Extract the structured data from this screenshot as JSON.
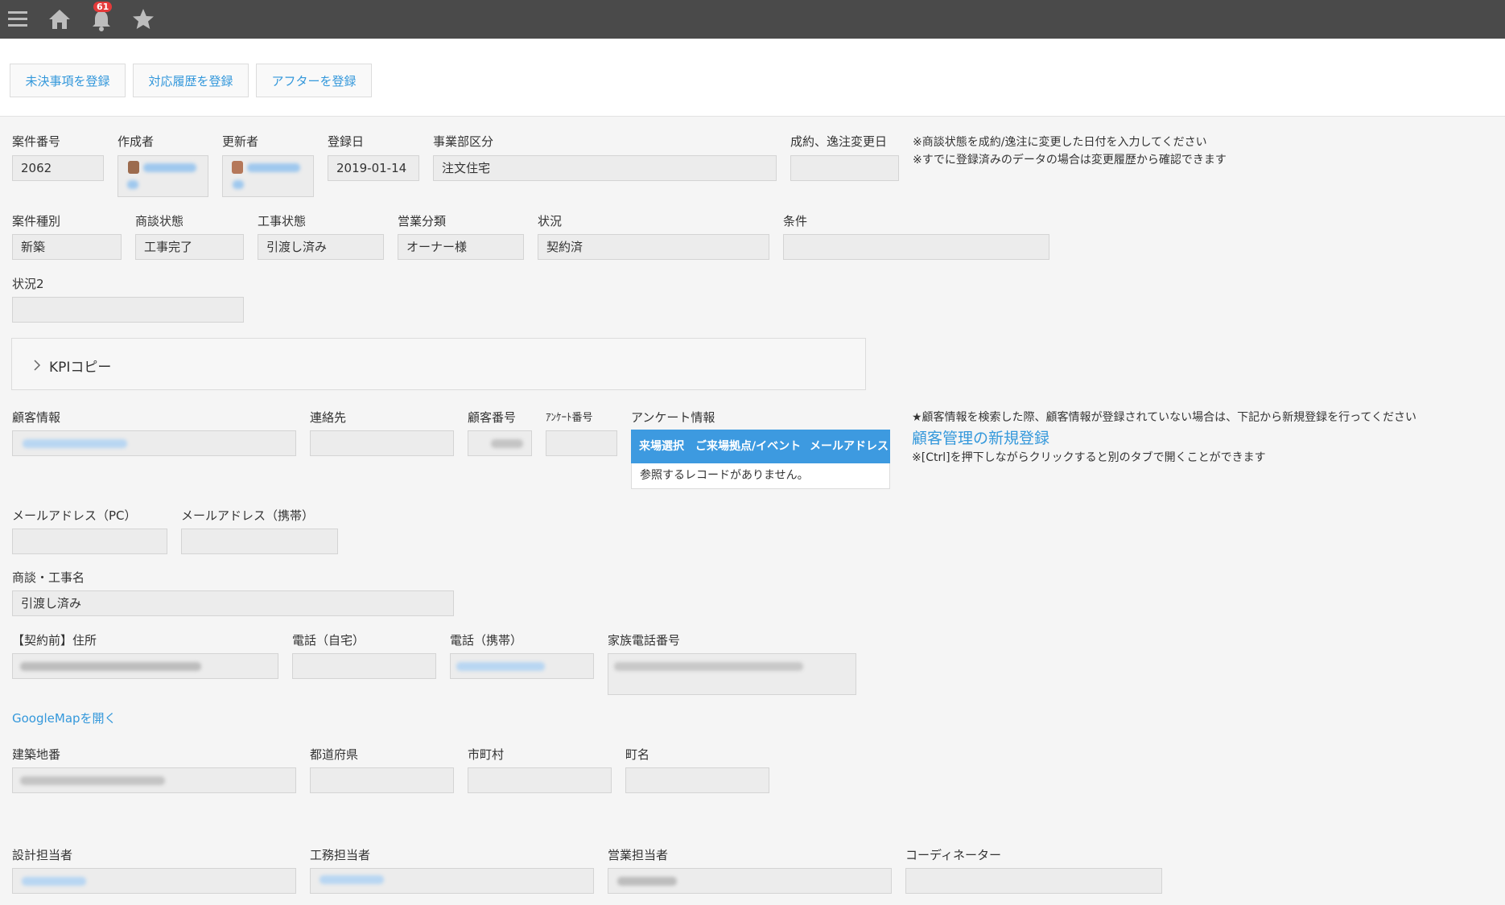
{
  "topbar": {
    "icons": [
      "menu-icon",
      "home-icon",
      "bell-icon",
      "star-icon"
    ],
    "notification_count": "61"
  },
  "actions": {
    "pending": "未決事項を登録",
    "history": "対応履歴を登録",
    "after": "アフターを登録"
  },
  "row1": {
    "case_no_label": "案件番号",
    "case_no": "2062",
    "creator_label": "作成者",
    "updater_label": "更新者",
    "reg_date_label": "登録日",
    "reg_date": "2019-01-14",
    "division_label": "事業部区分",
    "division": "注文住宅",
    "change_date_label": "成約、逸注変更日",
    "change_date": "",
    "note1": "※商談状態を成約/逸注に変更した日付を入力してください",
    "note2": "※すでに登録済みのデータの場合は変更履歴から確認できます"
  },
  "row2": {
    "case_type_label": "案件種別",
    "case_type": "新築",
    "deal_status_label": "商談状態",
    "deal_status": "工事完了",
    "work_status_label": "工事状態",
    "work_status": "引渡し済み",
    "sales_class_label": "営業分類",
    "sales_class": "オーナー様",
    "status_label": "状況",
    "status": "契約済",
    "condition_label": "条件",
    "condition": ""
  },
  "row3": {
    "status2_label": "状況2",
    "status2": ""
  },
  "kpi": {
    "label": "KPIコピー"
  },
  "customer": {
    "info_label": "顧客情報",
    "contact_label": "連絡先",
    "number_label": "顧客番号",
    "survey_no_label": "ｱﾝｹｰﾄ番号",
    "survey_info_label": "アンケート情報",
    "survey_tabs": [
      "来場選択",
      "ご来場拠点/イベント",
      "メールアドレス"
    ],
    "survey_empty": "参照するレコードがありません。",
    "note_search": "★顧客情報を検索した際、顧客情報が登録されていない場合は、下記から新規登録を行ってください",
    "new_registration_link": "顧客管理の新規登録",
    "note_ctrl": "※[Ctrl]を押下しながらクリックすると別のタブで開くことができます"
  },
  "email": {
    "pc_label": "メールアドレス（PC）",
    "mobile_label": "メールアドレス（携帯）"
  },
  "project": {
    "name_label": "商談・工事名",
    "name": "引渡し済み"
  },
  "address": {
    "pre_contract_label": "【契約前】住所",
    "tel_home_label": "電話（自宅）",
    "tel_mobile_label": "電話（携帯）",
    "family_tel_label": "家族電話番号",
    "map_link": "GoogleMapを開く",
    "lot_label": "建築地番",
    "pref_label": "都道府県",
    "city_label": "市町村",
    "town_label": "町名"
  },
  "staff": {
    "design_label": "設計担当者",
    "construction_label": "工務担当者",
    "sales_label": "営業担当者",
    "coordinator_label": "コーディネーター"
  },
  "colors": {
    "topbar": "#4a4a4a",
    "link": "#3498db",
    "field": "#ececec",
    "badge": "#e43a3a",
    "survey_header": "#3d9ae0"
  }
}
